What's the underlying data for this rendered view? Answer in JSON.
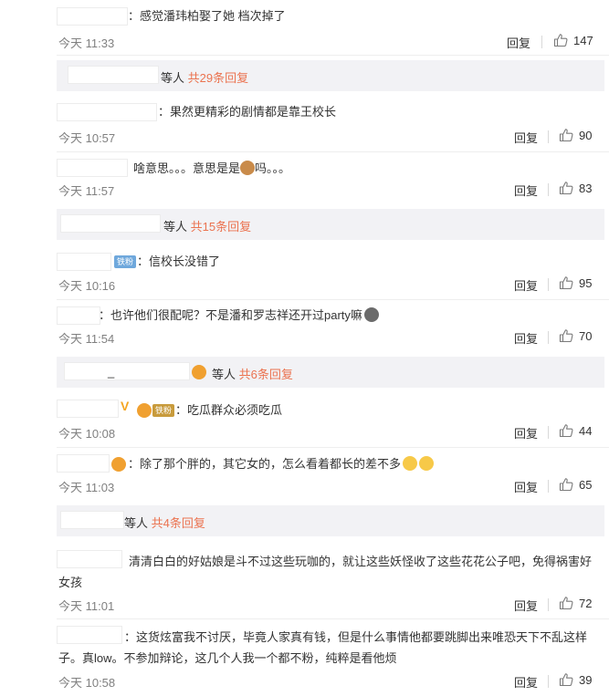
{
  "comments": [
    {
      "text": "：感觉潘玮柏娶了她 档次掉了",
      "time": "今天 11:33",
      "reply": "回复",
      "likes": "147"
    },
    {
      "text": "：果然更精彩的剧情都是靠王校长",
      "time": "今天 10:57",
      "reply": "回复",
      "likes": "90"
    },
    {
      "text": "啥意思。。。意思是是",
      "text2": "吗。。。",
      "time": "今天 11:57",
      "reply": "回复",
      "likes": "83"
    },
    {
      "badge": "铁粉",
      "text": "：信校长没错了",
      "time": "今天 10:16",
      "reply": "回复",
      "likes": "95"
    },
    {
      "text": "：也许他们很配呢？不是潘和罗志祥还开过party嘛",
      "time": "今天 11:54",
      "reply": "回复",
      "likes": "70"
    },
    {
      "badge_v": "V",
      "badge": "铁粉",
      "text": "：吃瓜群众必须吃瓜",
      "time": "今天 10:08",
      "reply": "回复",
      "likes": "44"
    },
    {
      "text": "：除了那个胖的，其它女的，怎么看着都长的差不多",
      "time": "今天 11:03",
      "reply": "回复",
      "likes": "65"
    },
    {
      "text": "清清白白的好姑娘是斗不过这些玩咖的，就让这些妖怪收了这些花花公子吧，免得祸害好女孩",
      "time": "今天 11:01",
      "reply": "回复",
      "likes": "72"
    },
    {
      "text": "：这货炫富我不讨厌，毕竟人家真有钱，但是什么事情他都要跳脚出来唯恐天下不乱这样子。真low。不参加辩论，这几个人我一个都不粉，纯粹是看他烦",
      "time": "今天 10:58",
      "reply": "回复",
      "likes": "39"
    }
  ],
  "sub_replies": [
    {
      "prefix": "等人",
      "more": "共29条回复"
    },
    {
      "prefix": "等人",
      "more": "共15条回复"
    },
    {
      "name_tail": "_",
      "prefix": "等人",
      "more": "共6条回复"
    },
    {
      "prefix": "等人",
      "more": "共4条回复"
    }
  ],
  "colors": {
    "accent": "#eb7350",
    "meta": "#808080",
    "subbar": "#f2f2f5",
    "badge": "#6fa8dc"
  },
  "icons": {
    "like": "thumb-up-icon"
  }
}
